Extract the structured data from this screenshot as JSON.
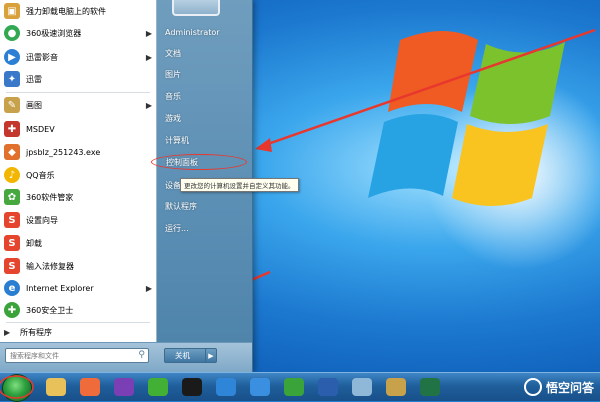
{
  "start_menu": {
    "programs": [
      {
        "label": "强力卸载电脑上的软件",
        "icon": "uninstall-icon",
        "color": "#d9a13b",
        "arrow": false
      },
      {
        "label": "360极速浏览器",
        "icon": "browser-360-icon",
        "color": "#33a852",
        "arrow": true
      },
      {
        "label": "迅雷影音",
        "icon": "xunlei-player-icon",
        "color": "#2d7fd3",
        "arrow": true
      },
      {
        "label": "迅雷",
        "icon": "xunlei-icon",
        "color": "#3a79c9",
        "arrow": false
      },
      {
        "label": "画图",
        "icon": "paint-icon",
        "color": "#c8a14b",
        "arrow": true
      },
      {
        "label": "MSDEV",
        "icon": "msdev-icon",
        "color": "#c4372c",
        "arrow": false
      },
      {
        "label": "jpsblz_251243.exe",
        "icon": "exe-icon",
        "color": "#e0702b",
        "arrow": false
      },
      {
        "label": "QQ音乐",
        "icon": "qq-music-icon",
        "color": "#f2b600",
        "arrow": false
      },
      {
        "label": "360软件管家",
        "icon": "software-manager-icon",
        "color": "#46a83e",
        "arrow": false
      },
      {
        "label": "设置向导",
        "icon": "sogou-icon",
        "color": "#e5452d",
        "arrow": false
      },
      {
        "label": "卸载",
        "icon": "sogou-icon",
        "color": "#e5452d",
        "arrow": false
      },
      {
        "label": "输入法修复器",
        "icon": "sogou-icon",
        "color": "#e5452d",
        "arrow": false
      },
      {
        "label": "Internet Explorer",
        "icon": "ie-icon",
        "color": "#2a7ed1",
        "arrow": true
      },
      {
        "label": "360安全卫士",
        "icon": "security-360-icon",
        "color": "#3aa33a",
        "arrow": false
      }
    ],
    "all_programs": "所有程序",
    "search_placeholder": "搜索程序和文件",
    "right_items": [
      {
        "label": "Administrator",
        "name": "user-administrator"
      },
      {
        "label": "文档",
        "name": "documents"
      },
      {
        "label": "图片",
        "name": "pictures"
      },
      {
        "label": "音乐",
        "name": "music"
      },
      {
        "label": "游戏",
        "name": "games"
      },
      {
        "label": "计算机",
        "name": "computer"
      },
      {
        "label": "控制面板",
        "name": "control-panel"
      },
      {
        "label": "设备",
        "name": "devices"
      },
      {
        "label": "默认程序",
        "name": "default-programs"
      },
      {
        "label": "运行...",
        "name": "run"
      }
    ],
    "tooltip": "更改您的计算机设置并自定义其功能。",
    "shutdown_label": "关机",
    "shutdown_arrow": "▶"
  },
  "taskbar": {
    "apps": [
      {
        "name": "explorer-icon",
        "color": "#e8c15a"
      },
      {
        "name": "360-browser-icon",
        "color": "#f06b3b"
      },
      {
        "name": "visual-studio-icon",
        "color": "#7b3fb5"
      },
      {
        "name": "wechat-icon",
        "color": "#41b035"
      },
      {
        "name": "qq-icon",
        "color": "#1a1a1a"
      },
      {
        "name": "xunlei-icon",
        "color": "#2f86d8"
      },
      {
        "name": "baidu-netdisk-icon",
        "color": "#3b8fe0"
      },
      {
        "name": "360-security-icon",
        "color": "#3aa33a"
      },
      {
        "name": "word-icon",
        "color": "#2b5fad"
      },
      {
        "name": "notepad-icon",
        "color": "#8fb8d8"
      },
      {
        "name": "paint-icon",
        "color": "#c8a14b"
      },
      {
        "name": "excel-icon",
        "color": "#217346"
      }
    ]
  },
  "watermark": "悟空问答"
}
